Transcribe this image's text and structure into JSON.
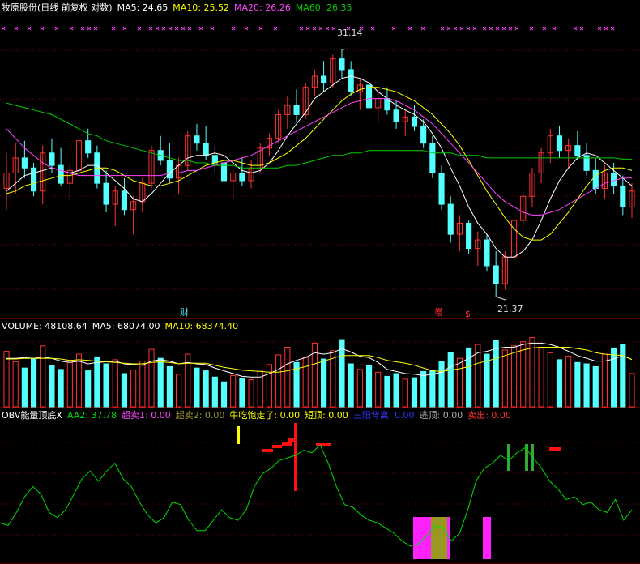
{
  "panel_price": {
    "title": "牧原股份(日线 前复权 对数)",
    "ma5_label": "MA5: 24.65",
    "ma10_label": "MA10: 25.52",
    "ma20_label": "MA20: 26.26",
    "ma60_label": "MA60: 26.35",
    "high_label": "31.14",
    "low_label": "21.37",
    "marker_cai": "财",
    "marker_zeng": "增",
    "marker_dollar": "$",
    "colors": {
      "up": "#ff3232",
      "down": "#54ffff",
      "ma5": "#ffffff",
      "ma10": "#ffff00",
      "ma20": "#ff44ff",
      "ma60": "#00cc00",
      "title": "#ffffff"
    }
  },
  "panel_volume": {
    "volume_label": "VOLUME: 48108.64",
    "ma5_label": "MA5: 68074.00",
    "ma10_label": "MA10: 68374.40"
  },
  "panel_obv": {
    "name_label": "OBV能量顶底X",
    "aa2_label": "AA2: 37.78",
    "chaomai1_label": "超卖1: 0.00",
    "chaomai2_label": "超卖2: 0.00",
    "niuchi_label": "牛吃饱走了: 0.00",
    "duanding_label": "短顶: 0.00",
    "sanyang_label": "三阳背离: 0.00",
    "taoding_label": "逃顶: 0.00",
    "maichu_label": "卖出: 0.00"
  },
  "chart_data": [
    {
      "type": "candlestick",
      "title": "牧原股份(日线 前复权 对数)",
      "scale": "log",
      "ylim": [
        20.8,
        32.6
      ],
      "annotations": [
        {
          "text": "31.14",
          "value": 31.14
        },
        {
          "text": "21.37",
          "value": 21.37
        }
      ],
      "candles": [
        [
          25.2,
          26.6,
          24.4,
          25.8
        ],
        [
          25.8,
          27.0,
          25.0,
          26.4
        ],
        [
          26.4,
          27.1,
          25.6,
          26.0
        ],
        [
          26.0,
          26.2,
          24.9,
          25.1
        ],
        [
          25.1,
          26.9,
          24.6,
          26.6
        ],
        [
          26.6,
          27.2,
          25.8,
          26.1
        ],
        [
          26.1,
          26.8,
          25.3,
          25.4
        ],
        [
          25.4,
          26.2,
          24.7,
          25.9
        ],
        [
          25.9,
          27.4,
          25.5,
          27.1
        ],
        [
          27.1,
          27.6,
          26.4,
          26.6
        ],
        [
          26.6,
          26.9,
          25.2,
          25.4
        ],
        [
          25.4,
          25.9,
          24.3,
          24.6
        ],
        [
          24.6,
          25.3,
          23.8,
          25.1
        ],
        [
          25.1,
          25.6,
          24.2,
          24.4
        ],
        [
          24.4,
          24.9,
          23.5,
          24.7
        ],
        [
          24.7,
          25.6,
          24.3,
          25.4
        ],
        [
          25.4,
          26.9,
          25.2,
          26.7
        ],
        [
          26.7,
          27.3,
          26.1,
          26.3
        ],
        [
          26.3,
          27.0,
          25.4,
          25.6
        ],
        [
          25.6,
          26.4,
          25.0,
          26.1
        ],
        [
          26.1,
          27.5,
          25.9,
          27.3
        ],
        [
          27.3,
          27.8,
          26.7,
          27.0
        ],
        [
          27.0,
          27.7,
          26.3,
          26.5
        ],
        [
          26.5,
          26.9,
          25.8,
          26.2
        ],
        [
          26.2,
          26.6,
          25.3,
          25.5
        ],
        [
          25.5,
          26.0,
          24.8,
          25.8
        ],
        [
          25.8,
          26.4,
          25.3,
          25.5
        ],
        [
          25.5,
          26.3,
          25.2,
          26.0
        ],
        [
          26.0,
          27.0,
          25.8,
          26.8
        ],
        [
          26.8,
          27.4,
          26.5,
          27.2
        ],
        [
          27.2,
          28.4,
          27.0,
          28.2
        ],
        [
          28.2,
          29.0,
          27.6,
          28.6
        ],
        [
          28.6,
          29.3,
          27.9,
          28.2
        ],
        [
          28.2,
          29.6,
          28.0,
          29.4
        ],
        [
          29.4,
          30.2,
          29.0,
          29.9
        ],
        [
          29.9,
          30.6,
          29.2,
          29.6
        ],
        [
          29.6,
          30.9,
          29.4,
          30.7
        ],
        [
          30.7,
          31.14,
          29.8,
          30.2
        ],
        [
          30.2,
          30.6,
          29.0,
          29.2
        ],
        [
          29.2,
          29.8,
          28.4,
          29.5
        ],
        [
          29.5,
          29.9,
          28.3,
          28.5
        ],
        [
          28.5,
          29.2,
          27.9,
          28.9
        ],
        [
          28.9,
          29.4,
          28.2,
          28.4
        ],
        [
          28.4,
          28.8,
          27.6,
          27.9
        ],
        [
          27.9,
          28.4,
          27.3,
          28.1
        ],
        [
          28.1,
          28.6,
          27.5,
          27.7
        ],
        [
          27.7,
          28.0,
          26.8,
          27.0
        ],
        [
          27.0,
          27.3,
          25.6,
          25.8
        ],
        [
          25.8,
          26.1,
          24.4,
          24.6
        ],
        [
          24.6,
          24.9,
          23.2,
          23.5
        ],
        [
          23.5,
          24.2,
          22.9,
          23.9
        ],
        [
          23.9,
          24.0,
          22.8,
          23.0
        ],
        [
          23.0,
          23.6,
          22.4,
          23.3
        ],
        [
          23.3,
          23.5,
          22.2,
          22.4
        ],
        [
          22.4,
          22.9,
          21.37,
          21.8
        ],
        [
          21.8,
          22.9,
          21.6,
          22.7
        ],
        [
          22.7,
          24.2,
          22.5,
          24.0
        ],
        [
          24.0,
          25.1,
          23.8,
          24.9
        ],
        [
          24.9,
          26.0,
          24.5,
          25.8
        ],
        [
          25.8,
          26.8,
          25.4,
          26.6
        ],
        [
          26.6,
          27.6,
          26.2,
          27.3
        ],
        [
          27.3,
          27.7,
          26.4,
          26.7
        ],
        [
          26.7,
          27.2,
          26.0,
          26.9
        ],
        [
          26.9,
          27.5,
          26.3,
          26.5
        ],
        [
          26.5,
          27.0,
          25.7,
          25.9
        ],
        [
          25.9,
          26.4,
          25.0,
          25.2
        ],
        [
          25.2,
          26.1,
          24.8,
          25.8
        ],
        [
          25.8,
          26.2,
          25.0,
          25.3
        ],
        [
          25.3,
          25.7,
          24.2,
          24.5
        ],
        [
          24.5,
          25.4,
          24.1,
          25.1
        ]
      ],
      "series": [
        {
          "name": "MA5",
          "values": [
            25.1,
            25.4,
            25.7,
            25.8,
            25.9,
            26.0,
            25.9,
            25.8,
            25.9,
            26.1,
            26.1,
            25.8,
            25.5,
            25.2,
            24.8,
            24.7,
            25.0,
            25.4,
            25.8,
            26.1,
            26.4,
            26.5,
            26.5,
            26.6,
            26.5,
            26.2,
            25.9,
            25.8,
            25.9,
            26.2,
            26.7,
            27.3,
            27.8,
            28.3,
            28.9,
            29.2,
            29.5,
            29.8,
            29.9,
            29.8,
            29.6,
            29.2,
            28.9,
            28.6,
            28.4,
            28.2,
            27.9,
            27.4,
            26.8,
            26.0,
            25.3,
            24.5,
            23.9,
            23.5,
            23.0,
            22.7,
            22.7,
            22.9,
            23.3,
            24.0,
            24.8,
            25.5,
            26.0,
            26.4,
            26.6,
            26.5,
            26.2,
            25.9,
            25.6,
            25.3
          ]
        },
        {
          "name": "MA10",
          "values": [
            25.0,
            25.1,
            25.3,
            25.4,
            25.5,
            25.6,
            25.7,
            25.7,
            25.8,
            25.9,
            26.0,
            26.0,
            25.9,
            25.7,
            25.5,
            25.4,
            25.3,
            25.3,
            25.4,
            25.5,
            25.7,
            25.9,
            26.1,
            26.2,
            26.3,
            26.3,
            26.2,
            26.1,
            26.1,
            26.2,
            26.4,
            26.6,
            26.9,
            27.2,
            27.6,
            28.0,
            28.4,
            28.8,
            29.1,
            29.3,
            29.4,
            29.4,
            29.3,
            29.2,
            29.0,
            28.8,
            28.5,
            28.2,
            27.8,
            27.4,
            26.9,
            26.3,
            25.7,
            25.1,
            24.6,
            24.1,
            23.7,
            23.4,
            23.3,
            23.3,
            23.5,
            23.9,
            24.3,
            24.8,
            25.3,
            25.7,
            25.9,
            26.0,
            26.0,
            25.9
          ]
        },
        {
          "name": "MA20",
          "values": [
            27.6,
            27.2,
            26.8,
            26.5,
            26.2,
            26.0,
            25.9,
            25.8,
            25.7,
            25.7,
            25.7,
            25.7,
            25.7,
            25.7,
            25.7,
            25.7,
            25.7,
            25.7,
            25.8,
            25.8,
            25.9,
            25.9,
            26.0,
            26.1,
            26.2,
            26.3,
            26.4,
            26.5,
            26.7,
            26.9,
            27.1,
            27.3,
            27.5,
            27.7,
            27.9,
            28.1,
            28.3,
            28.5,
            28.7,
            28.8,
            28.9,
            28.9,
            28.9,
            28.8,
            28.6,
            28.4,
            28.1,
            27.8,
            27.4,
            27.0,
            26.6,
            26.2,
            25.8,
            25.4,
            25.0,
            24.7,
            24.5,
            24.3,
            24.2,
            24.2,
            24.3,
            24.4,
            24.6,
            24.8,
            25.0,
            25.2,
            25.4,
            25.5,
            25.6,
            25.6
          ]
        },
        {
          "name": "MA60",
          "values": [
            28.7,
            28.6,
            28.5,
            28.4,
            28.3,
            28.2,
            28.0,
            27.8,
            27.6,
            27.4,
            27.3,
            27.1,
            27.0,
            26.9,
            26.8,
            26.7,
            26.6,
            26.5,
            26.4,
            26.3,
            26.3,
            26.2,
            26.2,
            26.1,
            26.1,
            26.1,
            26.0,
            26.0,
            26.0,
            26.0,
            26.0,
            26.1,
            26.1,
            26.2,
            26.3,
            26.4,
            26.5,
            26.5,
            26.6,
            26.6,
            26.7,
            26.7,
            26.7,
            26.7,
            26.7,
            26.7,
            26.7,
            26.6,
            26.6,
            26.6,
            26.5,
            26.5,
            26.5,
            26.4,
            26.4,
            26.4,
            26.4,
            26.4,
            26.4,
            26.4,
            26.4,
            26.4,
            26.4,
            26.4,
            26.4,
            26.4,
            26.4,
            26.4,
            26.35,
            26.35
          ]
        }
      ]
    },
    {
      "type": "bar",
      "title": "VOLUME",
      "ylim": [
        0,
        110000
      ],
      "values": [
        80000,
        65000,
        56000,
        70000,
        88000,
        60000,
        54000,
        64000,
        76000,
        52000,
        72000,
        62000,
        68000,
        48000,
        53000,
        66000,
        83000,
        70000,
        58000,
        47000,
        76000,
        56000,
        52000,
        43000,
        36000,
        45000,
        41000,
        39000,
        53000,
        61000,
        75000,
        86000,
        64000,
        71000,
        92000,
        69000,
        81000,
        97000,
        62000,
        54000,
        60000,
        50000,
        44000,
        48000,
        40000,
        42000,
        51000,
        53000,
        65000,
        78000,
        70000,
        85000,
        90000,
        76000,
        96000,
        82000,
        88000,
        94000,
        100000,
        86000,
        78000,
        68000,
        73000,
        64000,
        62000,
        58000,
        76000,
        85000,
        90000,
        48108.64
      ],
      "series": [
        {
          "name": "MA5",
          "values": [
            70000,
            70000,
            71000,
            70000,
            72000,
            70000,
            66000,
            64000,
            66000,
            62000,
            64000,
            65000,
            66000,
            62000,
            61000,
            60000,
            66000,
            68000,
            66000,
            62000,
            64000,
            62000,
            61000,
            56000,
            52000,
            48000,
            44000,
            43000,
            43000,
            48000,
            54000,
            62000,
            67000,
            71000,
            78000,
            76000,
            78000,
            84000,
            79000,
            73000,
            71000,
            64000,
            54000,
            51000,
            48000,
            47000,
            45000,
            47000,
            50000,
            58000,
            63000,
            70000,
            78000,
            80000,
            84000,
            86000,
            86000,
            90000,
            92000,
            92000,
            90000,
            86000,
            80000,
            74000,
            70000,
            66000,
            66000,
            69000,
            74000,
            68074
          ]
        },
        {
          "name": "MA10",
          "values": [
            69000,
            69000,
            70000,
            70000,
            70000,
            70000,
            69000,
            67000,
            68000,
            67000,
            66000,
            65000,
            64000,
            63000,
            62000,
            62000,
            64000,
            65000,
            64000,
            62000,
            63000,
            63000,
            63000,
            60000,
            57000,
            55000,
            53000,
            52000,
            51000,
            50000,
            50000,
            52000,
            55000,
            58000,
            62000,
            66000,
            70000,
            74000,
            74000,
            74000,
            74000,
            71000,
            67000,
            65000,
            63000,
            60000,
            56000,
            52000,
            51000,
            53000,
            55000,
            58000,
            63000,
            66000,
            70000,
            74000,
            78000,
            82000,
            85000,
            86000,
            86000,
            86000,
            86000,
            84000,
            82000,
            78000,
            76000,
            75000,
            74000,
            68374.4
          ]
        }
      ]
    },
    {
      "type": "line",
      "title": "OBV能量顶底X",
      "ylim": [
        0,
        100
      ],
      "series": [
        {
          "name": "AA2",
          "values": [
            28,
            26,
            36,
            48,
            56,
            50,
            36,
            32,
            38,
            50,
            62,
            68,
            60,
            68,
            74,
            62,
            56,
            44,
            34,
            28,
            32,
            44,
            42,
            30,
            22,
            22,
            30,
            38,
            32,
            30,
            38,
            56,
            66,
            70,
            76,
            78,
            80,
            84,
            82,
            88,
            74,
            56,
            42,
            40,
            34,
            30,
            28,
            24,
            20,
            14,
            10,
            12,
            18,
            26,
            24,
            14,
            20,
            38,
            60,
            70,
            74,
            80,
            76,
            82,
            86,
            78,
            70,
            60,
            54,
            46,
            48,
            42,
            44,
            38,
            36,
            46,
            30,
            38
          ]
        }
      ]
    }
  ]
}
